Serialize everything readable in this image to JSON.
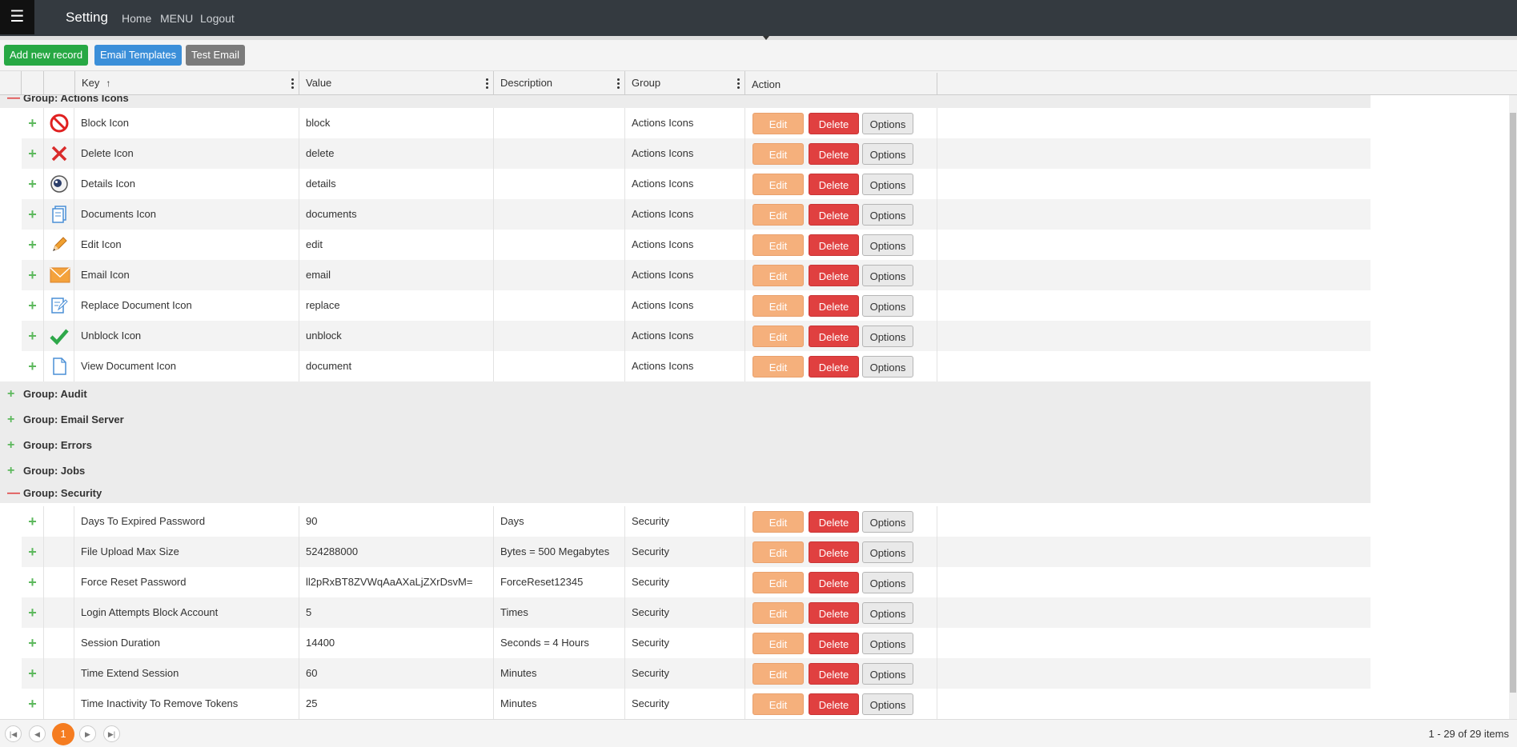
{
  "navbar": {
    "brand": "Setting",
    "menu_icon": "hamburger-icon",
    "links": [
      "Home",
      "MENU",
      "Logout"
    ],
    "background": "#343a40"
  },
  "toolbar": {
    "add_label": "Add new record",
    "templates_label": "Email Templates",
    "test_label": "Test Email",
    "colors": {
      "add": "#27a844",
      "templates": "#3b8fd9",
      "test": "#7b7b7b"
    }
  },
  "grid": {
    "columns": [
      "Key",
      "Value",
      "Description",
      "Group",
      "Action"
    ],
    "sort_icon": "sort-ascending-arrow-icon",
    "action_labels": {
      "edit": "Edit",
      "delete": "Delete",
      "options": "Options"
    },
    "groups": [
      {
        "label": "Group: Actions Icons",
        "expanded": true,
        "rows": [
          {
            "icon": "block-icon",
            "key": "Block Icon",
            "value": "block",
            "description": "",
            "group": "Actions Icons"
          },
          {
            "icon": "delete-x-icon",
            "key": "Delete Icon",
            "value": "delete",
            "description": "",
            "group": "Actions Icons"
          },
          {
            "icon": "eye-icon",
            "key": "Details Icon",
            "value": "details",
            "description": "",
            "group": "Actions Icons"
          },
          {
            "icon": "documents-icon",
            "key": "Documents Icon",
            "value": "documents",
            "description": "",
            "group": "Actions Icons"
          },
          {
            "icon": "pencil-icon",
            "key": "Edit Icon",
            "value": "edit",
            "description": "",
            "group": "Actions Icons"
          },
          {
            "icon": "envelope-icon",
            "key": "Email Icon",
            "value": "email",
            "description": "",
            "group": "Actions Icons"
          },
          {
            "icon": "replace-document-icon",
            "key": "Replace Document Icon",
            "value": "replace",
            "description": "",
            "group": "Actions Icons"
          },
          {
            "icon": "checkmark-icon",
            "key": "Unblock Icon",
            "value": "unblock",
            "description": "",
            "group": "Actions Icons"
          },
          {
            "icon": "document-icon",
            "key": "View Document Icon",
            "value": "document",
            "description": "",
            "group": "Actions Icons"
          }
        ]
      },
      {
        "label": "Group: Audit",
        "expanded": false,
        "rows": []
      },
      {
        "label": "Group: Email Server",
        "expanded": false,
        "rows": []
      },
      {
        "label": "Group: Errors",
        "expanded": false,
        "rows": []
      },
      {
        "label": "Group: Jobs",
        "expanded": false,
        "rows": []
      },
      {
        "label": "Group: Security",
        "expanded": true,
        "rows": [
          {
            "icon": "",
            "key": "Days To Expired Password",
            "value": "90",
            "description": "Days",
            "group": "Security"
          },
          {
            "icon": "",
            "key": "File Upload Max Size",
            "value": "524288000",
            "description": "Bytes = 500 Megabytes",
            "group": "Security"
          },
          {
            "icon": "",
            "key": "Force Reset Password",
            "value": "ll2pRxBT8ZVWqAaAXaLjZXrDsvM=",
            "description": "ForceReset12345",
            "group": "Security"
          },
          {
            "icon": "",
            "key": "Login Attempts Block Account",
            "value": "5",
            "description": "Times",
            "group": "Security"
          },
          {
            "icon": "",
            "key": "Session Duration",
            "value": "14400",
            "description": "Seconds = 4 Hours",
            "group": "Security"
          },
          {
            "icon": "",
            "key": "Time Extend Session",
            "value": "60",
            "description": "Minutes",
            "group": "Security"
          },
          {
            "icon": "",
            "key": "Time Inactivity To Remove Tokens",
            "value": "25",
            "description": "Minutes",
            "group": "Security"
          }
        ]
      }
    ]
  },
  "pager": {
    "current_page": "1",
    "summary": "1 - 29 of 29 items",
    "accent": "#f57c20"
  }
}
